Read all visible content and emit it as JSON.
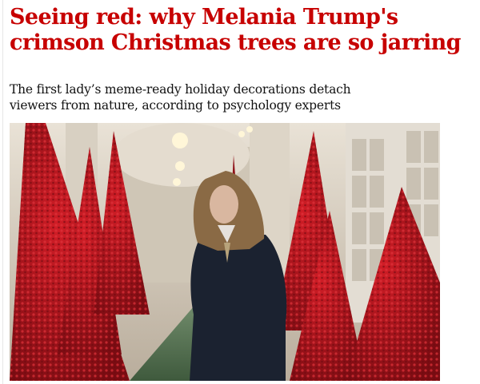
{
  "article": {
    "headline_lines": [
      "Seeing red: why Melania Trump's",
      "crimson Christmas trees are so jarring"
    ],
    "standfirst_lines": [
      "The first lady’s meme-ready holiday decorations detach",
      "viewers from nature, according to psychology experts"
    ]
  },
  "colors": {
    "headline": "#c70000",
    "standfirst": "#121212",
    "tree_red": "#b3121b"
  },
  "icons": {
    "photo": "hero-photo-red-christmas-trees-hallway"
  }
}
